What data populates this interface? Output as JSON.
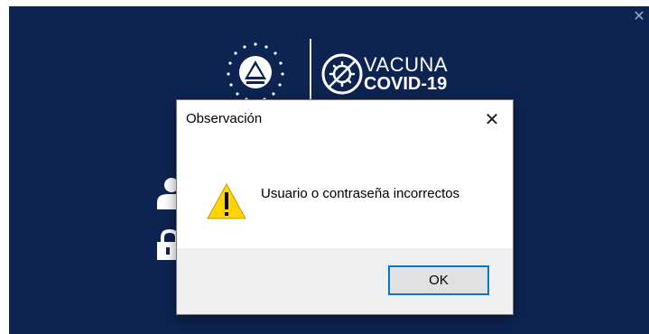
{
  "app": {
    "close_glyph": "✕",
    "logo_line1": "VACUNA",
    "logo_line2": "COVID-19",
    "background_color": "#0d2452",
    "icons": [
      "seal-emblem-icon",
      "vaccine-logo-icon",
      "user-icon",
      "lock-icon"
    ]
  },
  "dialog": {
    "title": "Observación",
    "close_glyph": "✕",
    "message": "Usuario o contraseña incorrectos",
    "icon": "warning-icon",
    "ok_label": "OK",
    "accent_color": "#0078d7",
    "warning_color": "#ffd400"
  }
}
